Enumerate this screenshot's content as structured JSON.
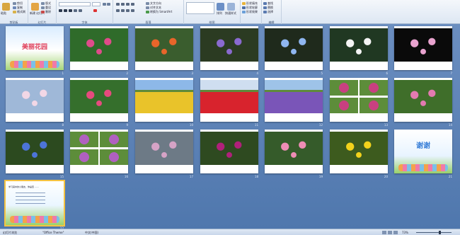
{
  "ribbon": {
    "groups": [
      {
        "label": "剪贴板"
      },
      {
        "label": "幻灯片"
      },
      {
        "label": "字体"
      },
      {
        "label": "段落"
      },
      {
        "label": "绘图"
      },
      {
        "label": "编辑"
      }
    ],
    "paste_label": "粘贴",
    "new_slide_label": "新建\n幻灯片",
    "layout_label": "版式",
    "reset_label": "重设",
    "delete_label": "删除",
    "cut_label": "剪切",
    "copy_label": "复制",
    "format_painter_label": "格式刷",
    "text_direction_label": "文字方向",
    "align_text_label": "对齐文本",
    "smartart_label": "转换为 SmartArt",
    "arrange_label": "排列",
    "quick_styles_label": "快速样式",
    "shape_fill_label": "形状填充",
    "shape_outline_label": "形状轮廓",
    "shape_effects_label": "形状效果",
    "find_label": "查找",
    "replace_label": "替换",
    "select_label": "选择"
  },
  "slides": [
    {
      "num": "1",
      "title": "美丽花园",
      "kind": "title"
    },
    {
      "num": "2",
      "kind": "photo",
      "bg": "#2f6b2a",
      "accent": "#e04b8a"
    },
    {
      "num": "3",
      "kind": "photo",
      "bg": "#3a5d2e",
      "accent": "#e8652a"
    },
    {
      "num": "4",
      "kind": "photo",
      "bg": "#2b3b22",
      "accent": "#8a6ad0"
    },
    {
      "num": "5",
      "kind": "photo",
      "bg": "#1f2a1c",
      "accent": "#8fb6f0"
    },
    {
      "num": "6",
      "kind": "photo",
      "bg": "#203822",
      "accent": "#f4f4f4"
    },
    {
      "num": "7",
      "kind": "photo",
      "bg": "#0a0a0a",
      "accent": "#e9a3cf"
    },
    {
      "num": "8",
      "kind": "photo",
      "bg": "#9fb8d8",
      "accent": "#f2d7e6"
    },
    {
      "num": "9",
      "kind": "photo",
      "bg": "#356f2c",
      "accent": "#e64a7e"
    },
    {
      "num": "10",
      "kind": "field",
      "bg": "#8db8e8",
      "accent": "#e9c32a"
    },
    {
      "num": "11",
      "kind": "field",
      "bg": "#cfdef0",
      "accent": "#d8232d"
    },
    {
      "num": "12",
      "kind": "field",
      "bg": "#9ec3e8",
      "accent": "#7a55b8"
    },
    {
      "num": "13",
      "kind": "collage",
      "bg": "#ffffff",
      "accent": "#c84080"
    },
    {
      "num": "14",
      "kind": "photo",
      "bg": "#3f6e2a",
      "accent": "#e37ab0"
    },
    {
      "num": "15",
      "kind": "photo",
      "bg": "#2c4a1f",
      "accent": "#4c74d8"
    },
    {
      "num": "16",
      "kind": "collage",
      "bg": "#ffffff",
      "accent": "#b060c0"
    },
    {
      "num": "17",
      "kind": "photo",
      "bg": "#6d7a86",
      "accent": "#d6a3c6"
    },
    {
      "num": "18",
      "kind": "photo",
      "bg": "#2e4a20",
      "accent": "#b0207a"
    },
    {
      "num": "19",
      "kind": "photo",
      "bg": "#355b2a",
      "accent": "#ee8db5"
    },
    {
      "num": "20",
      "kind": "photo",
      "bg": "#3d5b1e",
      "accent": "#f3d21b"
    },
    {
      "num": "21",
      "title": "谢谢",
      "kind": "thanks"
    },
    {
      "num": "22",
      "kind": "text",
      "title": "学习其中的小朋友，你是否 ……"
    }
  ],
  "status": {
    "slide_label": "幻灯片浏览",
    "theme_label": "\"Office Theme\"",
    "language_label": "中文(中国)",
    "zoom_label": "73%"
  }
}
